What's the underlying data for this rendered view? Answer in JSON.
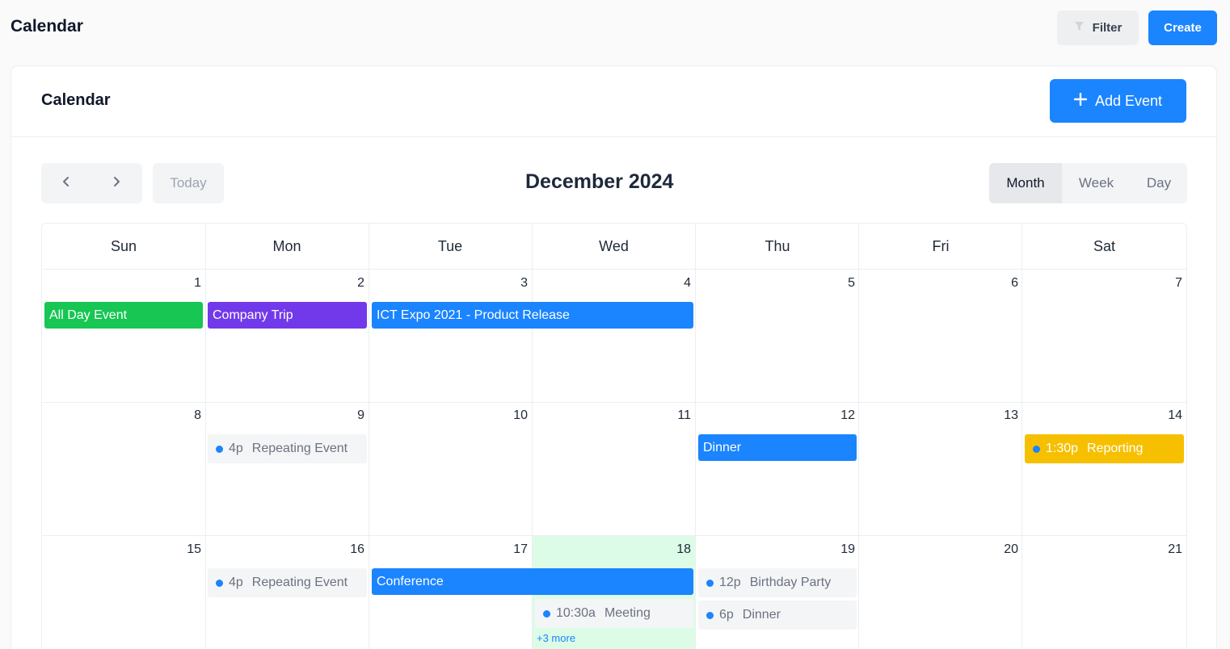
{
  "header": {
    "title": "Calendar",
    "filter_label": "Filter",
    "create_label": "Create"
  },
  "card": {
    "title": "Calendar",
    "add_event_label": "Add Event"
  },
  "toolbar": {
    "today_label": "Today",
    "month_title": "December 2024",
    "views": [
      "Month",
      "Week",
      "Day"
    ],
    "active_view": "Month"
  },
  "days_of_week": [
    "Sun",
    "Mon",
    "Tue",
    "Wed",
    "Thu",
    "Fri",
    "Sat"
  ],
  "weeks": [
    [
      "1",
      "2",
      "3",
      "4",
      "5",
      "6",
      "7"
    ],
    [
      "8",
      "9",
      "10",
      "11",
      "12",
      "13",
      "14"
    ],
    [
      "15",
      "16",
      "17",
      "18",
      "19",
      "20",
      "21"
    ]
  ],
  "today_date": "18",
  "events": {
    "all_day": "All Day Event",
    "company_trip": "Company Trip",
    "ict_expo": "ICT Expo 2021 - Product Release",
    "repeating_1": {
      "time": "4p",
      "title": "Repeating Event"
    },
    "dinner_12": "Dinner",
    "reporting": {
      "time": "1:30p",
      "title": "Reporting"
    },
    "repeating_2": {
      "time": "4p",
      "title": "Repeating Event"
    },
    "conference": "Conference",
    "meeting": {
      "time": "10:30a",
      "title": "Meeting"
    },
    "more": "+3 more",
    "birthday": {
      "time": "12p",
      "title": "Birthday Party"
    },
    "dinner_19": {
      "time": "6p",
      "title": "Dinner"
    }
  },
  "colors": {
    "primary": "#1b84ff",
    "success": "#17c653",
    "purple": "#7239ea",
    "warning": "#f6c000",
    "today_bg": "#dcfce7"
  }
}
